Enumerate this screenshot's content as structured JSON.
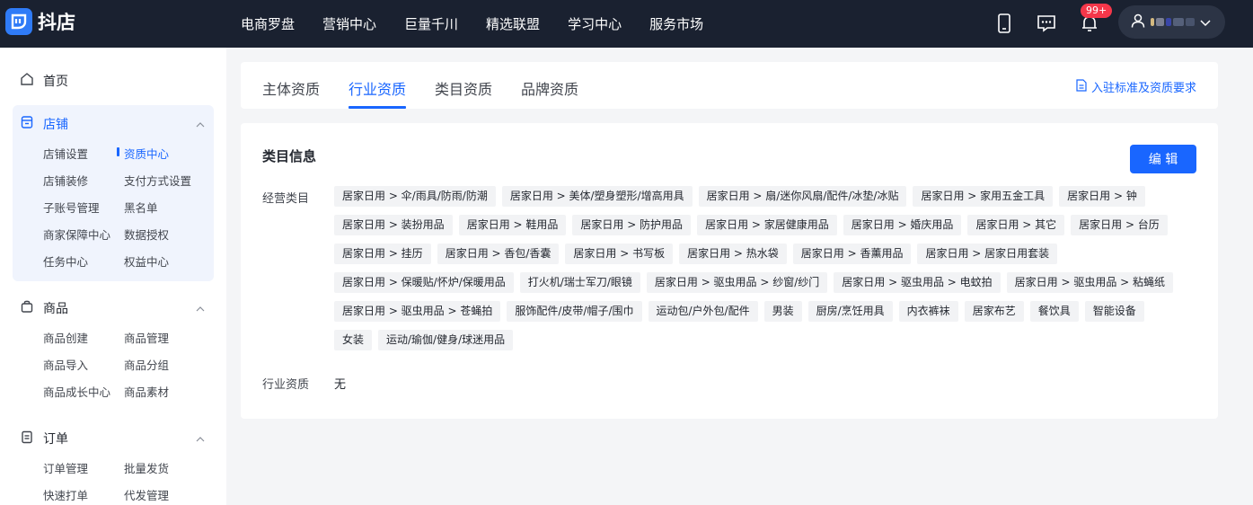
{
  "brand": {
    "name": "抖店",
    "accent": "#1966ff"
  },
  "top_nav": [
    "电商罗盘",
    "营销中心",
    "巨量千川",
    "精选联盟",
    "学习中心",
    "服务市场"
  ],
  "notifications": {
    "badge": "99+"
  },
  "sidebar": {
    "home": "首页",
    "groups": [
      {
        "title": "店铺",
        "items": [
          "店铺设置",
          "资质中心",
          "店铺装修",
          "支付方式设置",
          "子账号管理",
          "黑名单",
          "商家保障中心",
          "数据授权",
          "任务中心",
          "权益中心"
        ],
        "active": "资质中心"
      },
      {
        "title": "商品",
        "items": [
          "商品创建",
          "商品管理",
          "商品导入",
          "商品分组",
          "商品成长中心",
          "商品素材"
        ]
      },
      {
        "title": "订单",
        "items": [
          "订单管理",
          "批量发货",
          "快速打单",
          "代发管理"
        ]
      }
    ]
  },
  "tabs": [
    "主体资质",
    "行业资质",
    "类目资质",
    "品牌资质"
  ],
  "active_tab": "行业资质",
  "requirements_link": "入驻标准及资质要求",
  "info": {
    "title": "类目信息",
    "edit_label": "编 辑",
    "category_label": "经营类目",
    "categories": [
      "居家日用 > 伞/雨具/防雨/防潮",
      "居家日用 > 美体/塑身塑形/增高用具",
      "居家日用 > 扇/迷你风扇/配件/冰垫/冰贴",
      "居家日用 > 家用五金工具",
      "居家日用 > 钟",
      "居家日用 > 装扮用品",
      "居家日用 > 鞋用品",
      "居家日用 > 防护用品",
      "居家日用 > 家居健康用品",
      "居家日用 > 婚庆用品",
      "居家日用 > 其它",
      "居家日用 > 台历",
      "居家日用 > 挂历",
      "居家日用 > 香包/香囊",
      "居家日用 > 书写板",
      "居家日用 > 热水袋",
      "居家日用 > 香薰用品",
      "居家日用 > 居家日用套装",
      "居家日用 > 保暖贴/怀炉/保暖用品",
      "打火机/瑞士军刀/眼镜",
      "居家日用 > 驱虫用品 > 纱窗/纱门",
      "居家日用 > 驱虫用品 > 电蚊拍",
      "居家日用 > 驱虫用品 > 粘蝇纸",
      "居家日用 > 驱虫用品 > 苍蝇拍",
      "服饰配件/皮带/帽子/围巾",
      "运动包/户外包/配件",
      "男装",
      "厨房/烹饪用具",
      "内衣裤袜",
      "居家布艺",
      "餐饮具",
      "智能设备",
      "女装",
      "运动/瑜伽/健身/球迷用品"
    ],
    "industry_label": "行业资质",
    "industry_value": "无"
  }
}
